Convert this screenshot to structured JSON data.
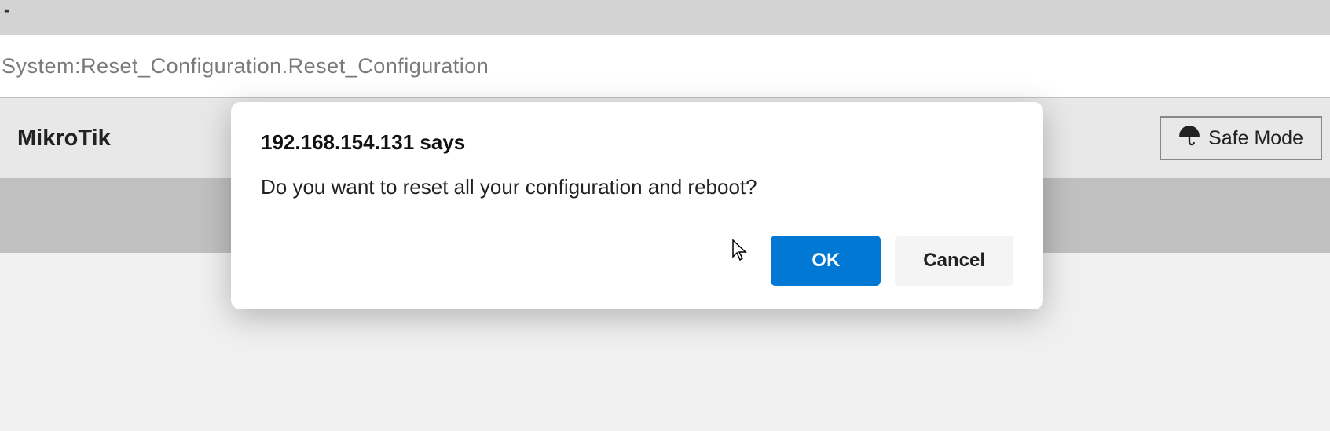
{
  "window": {
    "dash": "-"
  },
  "address_bar": {
    "path": "System:Reset_Configuration.Reset_Configuration"
  },
  "header": {
    "brand": "MikroTik",
    "safe_mode_label": "Safe Mode"
  },
  "dialog": {
    "source_ip": "192.168.154.131",
    "says_suffix": " says",
    "message": "Do you want to reset all your configuration and reboot?",
    "ok_label": "OK",
    "cancel_label": "Cancel"
  }
}
